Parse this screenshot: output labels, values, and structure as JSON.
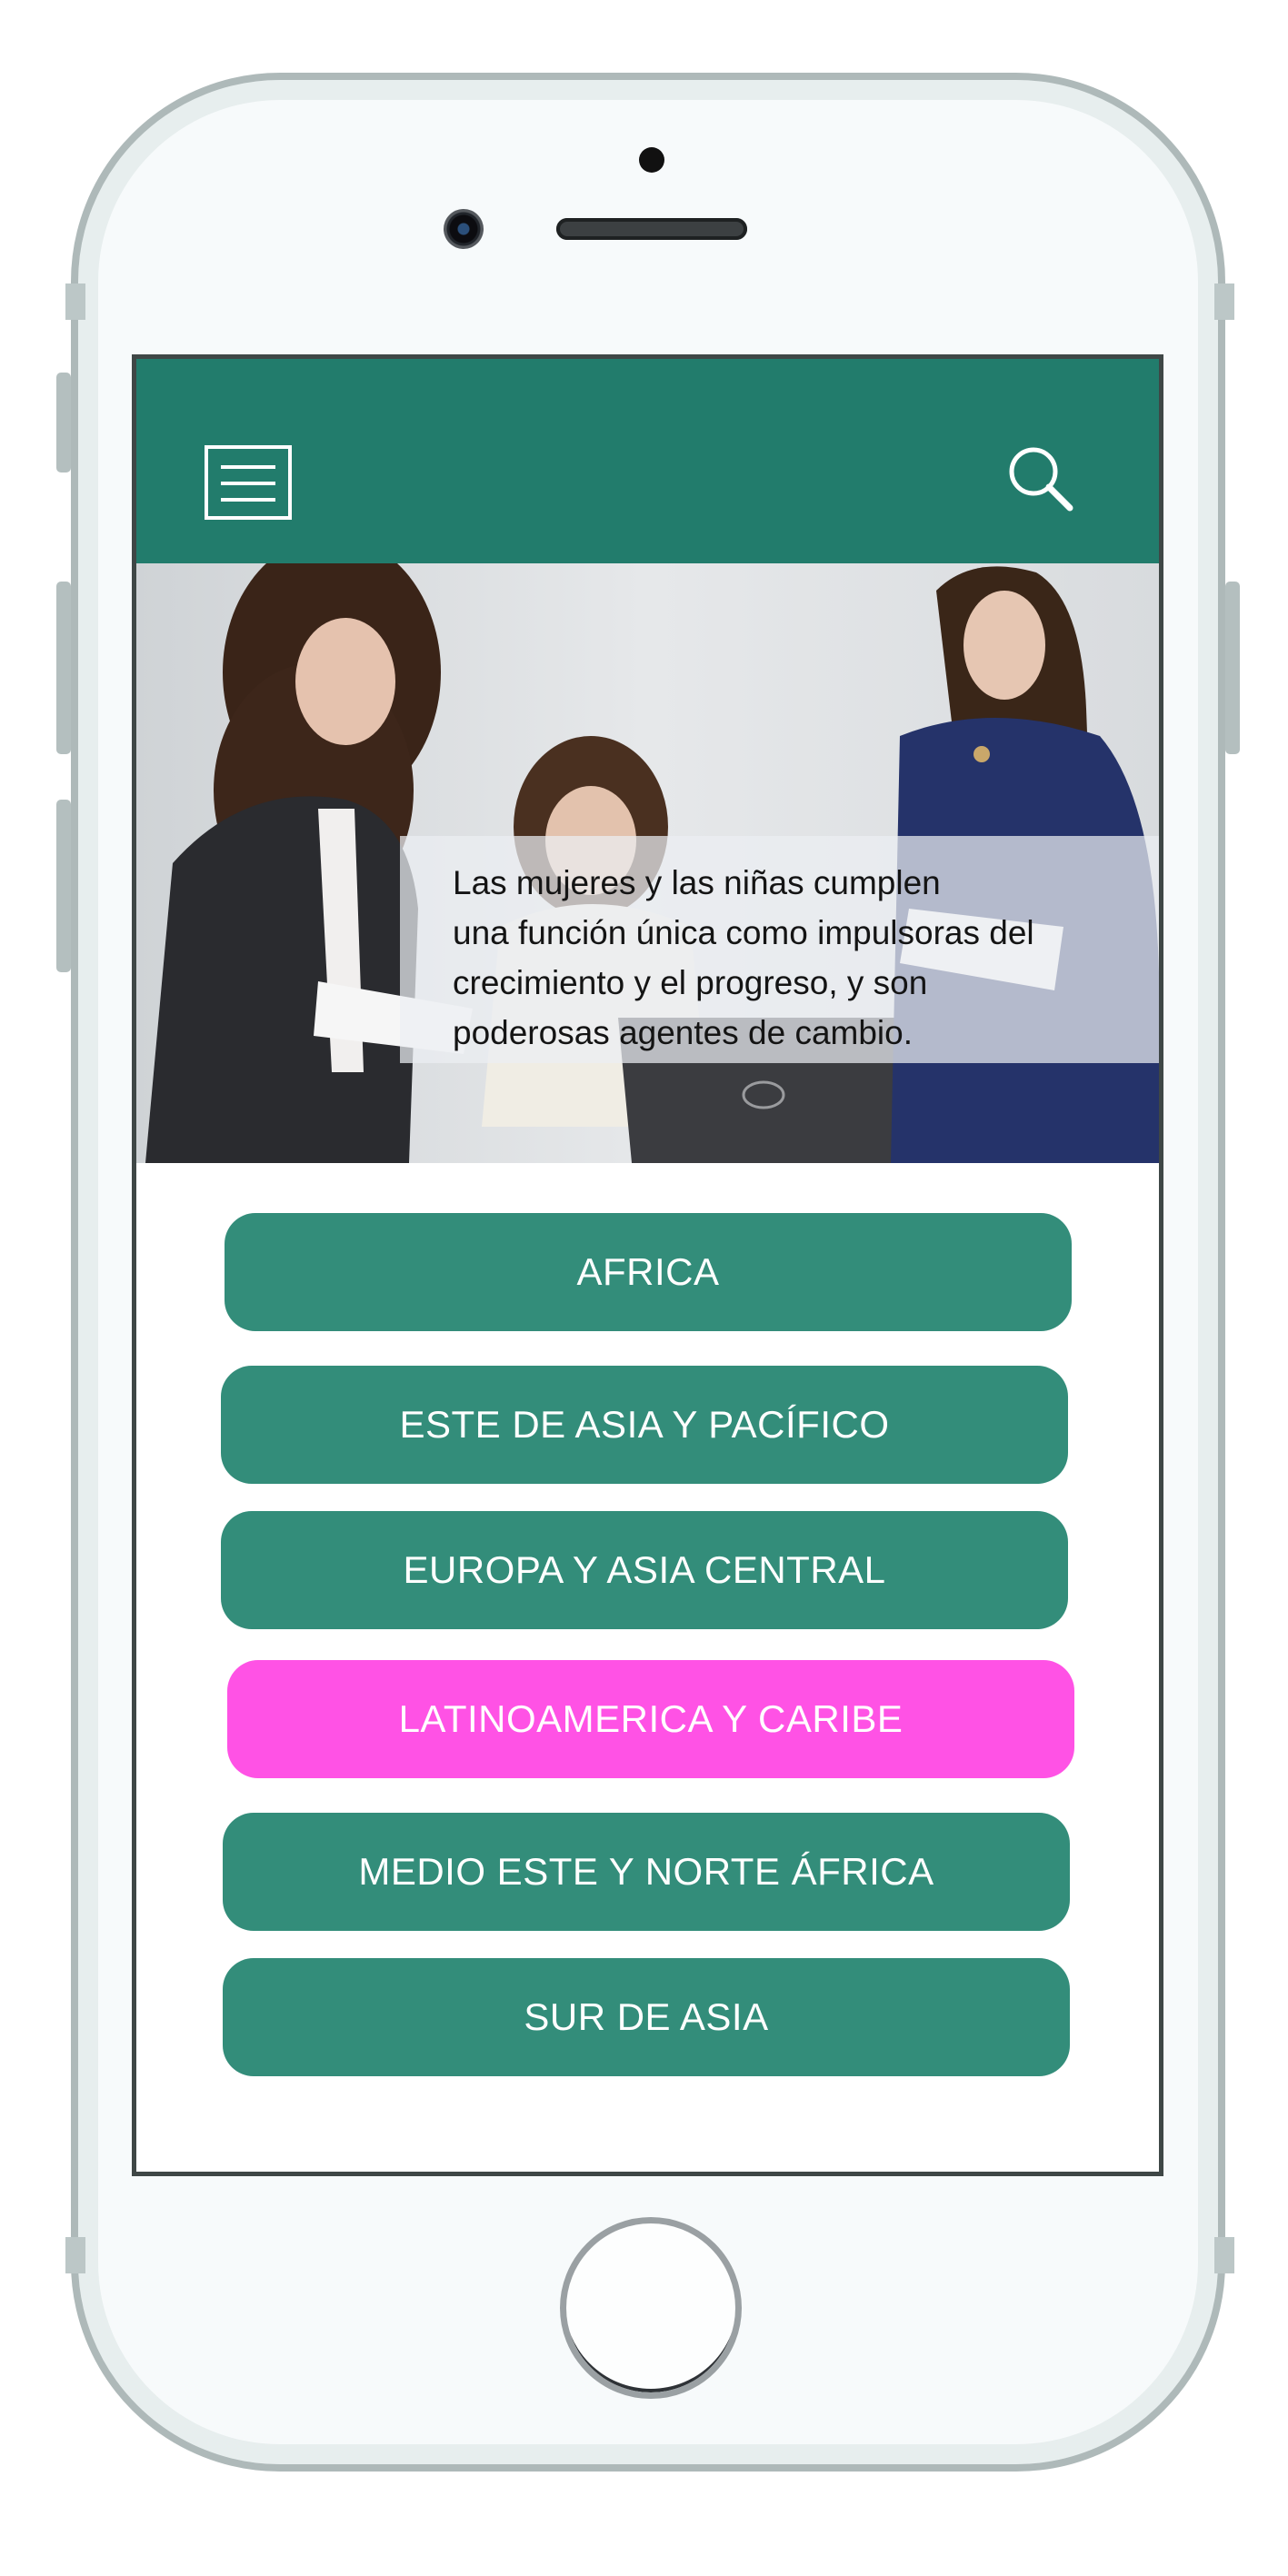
{
  "header": {
    "menu_icon": "hamburger-menu-icon",
    "search_icon": "search-icon",
    "color": "#227c6c"
  },
  "hero": {
    "caption_lines": [
      "Las mujeres y las niñas cumplen",
      "una función única como impulsoras del",
      "crecimiento y el progreso, y son",
      "poderosas agentes de cambio."
    ]
  },
  "regions": {
    "button_color": "#338d7a",
    "active_color": "#ff52e5",
    "items": [
      {
        "label": "AFRICA",
        "active": false
      },
      {
        "label": "ESTE DE ASIA Y PACÍFICO",
        "active": false
      },
      {
        "label": "EUROPA Y ASIA CENTRAL",
        "active": false
      },
      {
        "label": "LATINOAMERICA Y CARIBE",
        "active": true
      },
      {
        "label": "MEDIO ESTE Y NORTE ÁFRICA",
        "active": false
      },
      {
        "label": "SUR DE ASIA",
        "active": false
      }
    ]
  }
}
